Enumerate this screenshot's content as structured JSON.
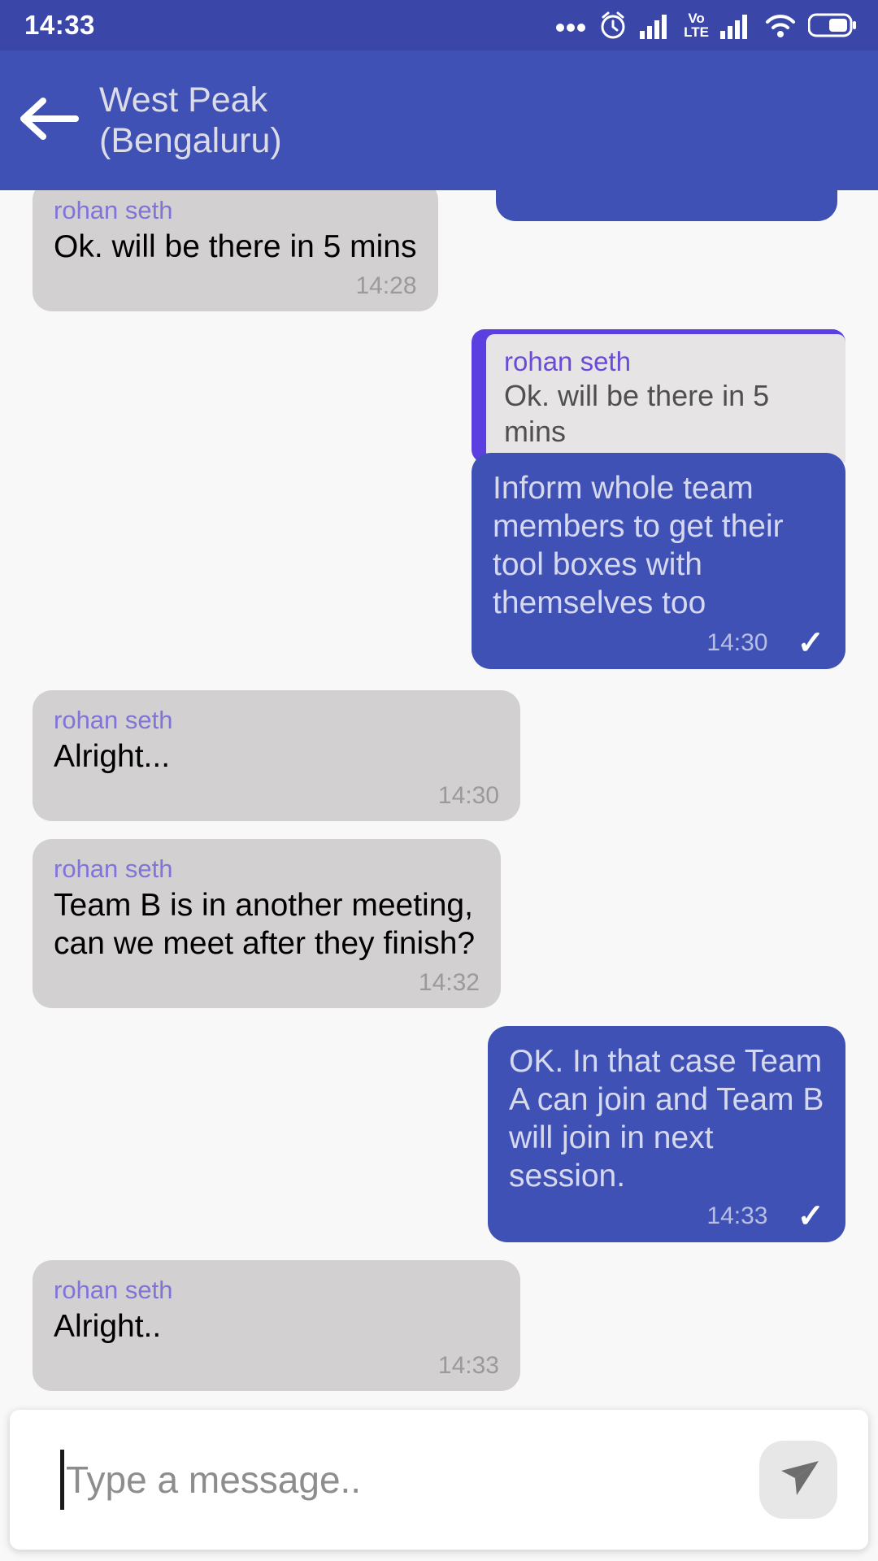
{
  "status_bar": {
    "time": "14:33",
    "icons": [
      "more-dots-icon",
      "alarm-icon",
      "signal-bars-icon",
      "volte-icon",
      "signal-bars-2-icon",
      "wifi-icon",
      "battery-icon"
    ],
    "volte_label_top": "Vo",
    "volte_label_bottom": "LTE",
    "background": "#3b47a8"
  },
  "header": {
    "back_icon": "back-arrow-icon",
    "title_line1": "West Peak",
    "title_line2": "(Bengaluru)",
    "background": "#3f51b5",
    "title_color": "#dcdce8"
  },
  "theme": {
    "chat_background": "#f8f8f9",
    "incoming_bubble": "#d2d0d0",
    "outgoing_bubble": "#3f51b5",
    "sender_name_color": "#8074d8",
    "quote_accent": "#5b3fe0",
    "quote_inner": "#e6e4e4",
    "timestamp_incoming": "#9a9a9a",
    "timestamp_outgoing": "#b8bfe3"
  },
  "messages": [
    {
      "id": "m1",
      "direction": "incoming",
      "sender": "rohan seth",
      "text": "Ok. will be there in 5 mins",
      "time": "14:28"
    },
    {
      "id": "m2",
      "direction": "outgoing",
      "quote": {
        "sender": "rohan seth",
        "text": "Ok. will be there in 5 mins"
      },
      "text": "Inform whole team members to get their tool boxes with themselves too",
      "time": "14:30",
      "status_icon": "✓"
    },
    {
      "id": "m3",
      "direction": "incoming",
      "sender": "rohan seth",
      "text": "Alright...",
      "time": "14:30"
    },
    {
      "id": "m4",
      "direction": "incoming",
      "sender": "rohan seth",
      "text": "Team B is in another meeting, can we meet after they finish?",
      "time": "14:32"
    },
    {
      "id": "m5",
      "direction": "outgoing",
      "text": "OK. In that case Team A can join and Team B will join in next session.",
      "time": "14:33",
      "status_icon": "✓"
    },
    {
      "id": "m6",
      "direction": "incoming",
      "sender": "rohan seth",
      "text": "Alright..",
      "time": "14:33"
    }
  ],
  "composer": {
    "placeholder": "Type a message..",
    "value": "",
    "send_icon": "send-paper-plane-icon",
    "send_button_bg": "#e7e7e7"
  }
}
